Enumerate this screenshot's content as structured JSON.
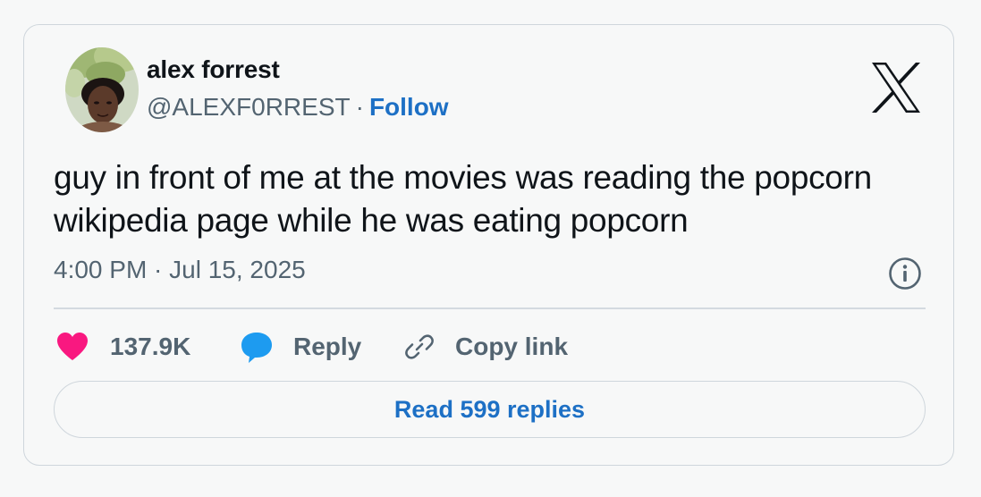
{
  "tweet": {
    "author": {
      "display_name": "alex forrest",
      "handle": "@ALEXF0RREST",
      "separator": "·",
      "follow_label": "Follow"
    },
    "text": "guy in front of me at the movies was reading the popcorn wikipedia page while he was eating popcorn",
    "timestamp": "4:00 PM · Jul 15, 2025",
    "actions": {
      "like_count": "137.9K",
      "reply_label": "Reply",
      "copy_link_label": "Copy link"
    },
    "read_replies_label": "Read 599 replies"
  },
  "icons": {
    "brand": "x-logo-icon",
    "info": "info-icon",
    "like": "heart-icon",
    "reply": "speech-bubble-icon",
    "copy": "link-icon"
  },
  "colors": {
    "link_blue": "#1d70c5",
    "heart_pink": "#f91880",
    "reply_blue": "#1d9bf0",
    "muted_text": "#536471",
    "text": "#0f1419"
  }
}
